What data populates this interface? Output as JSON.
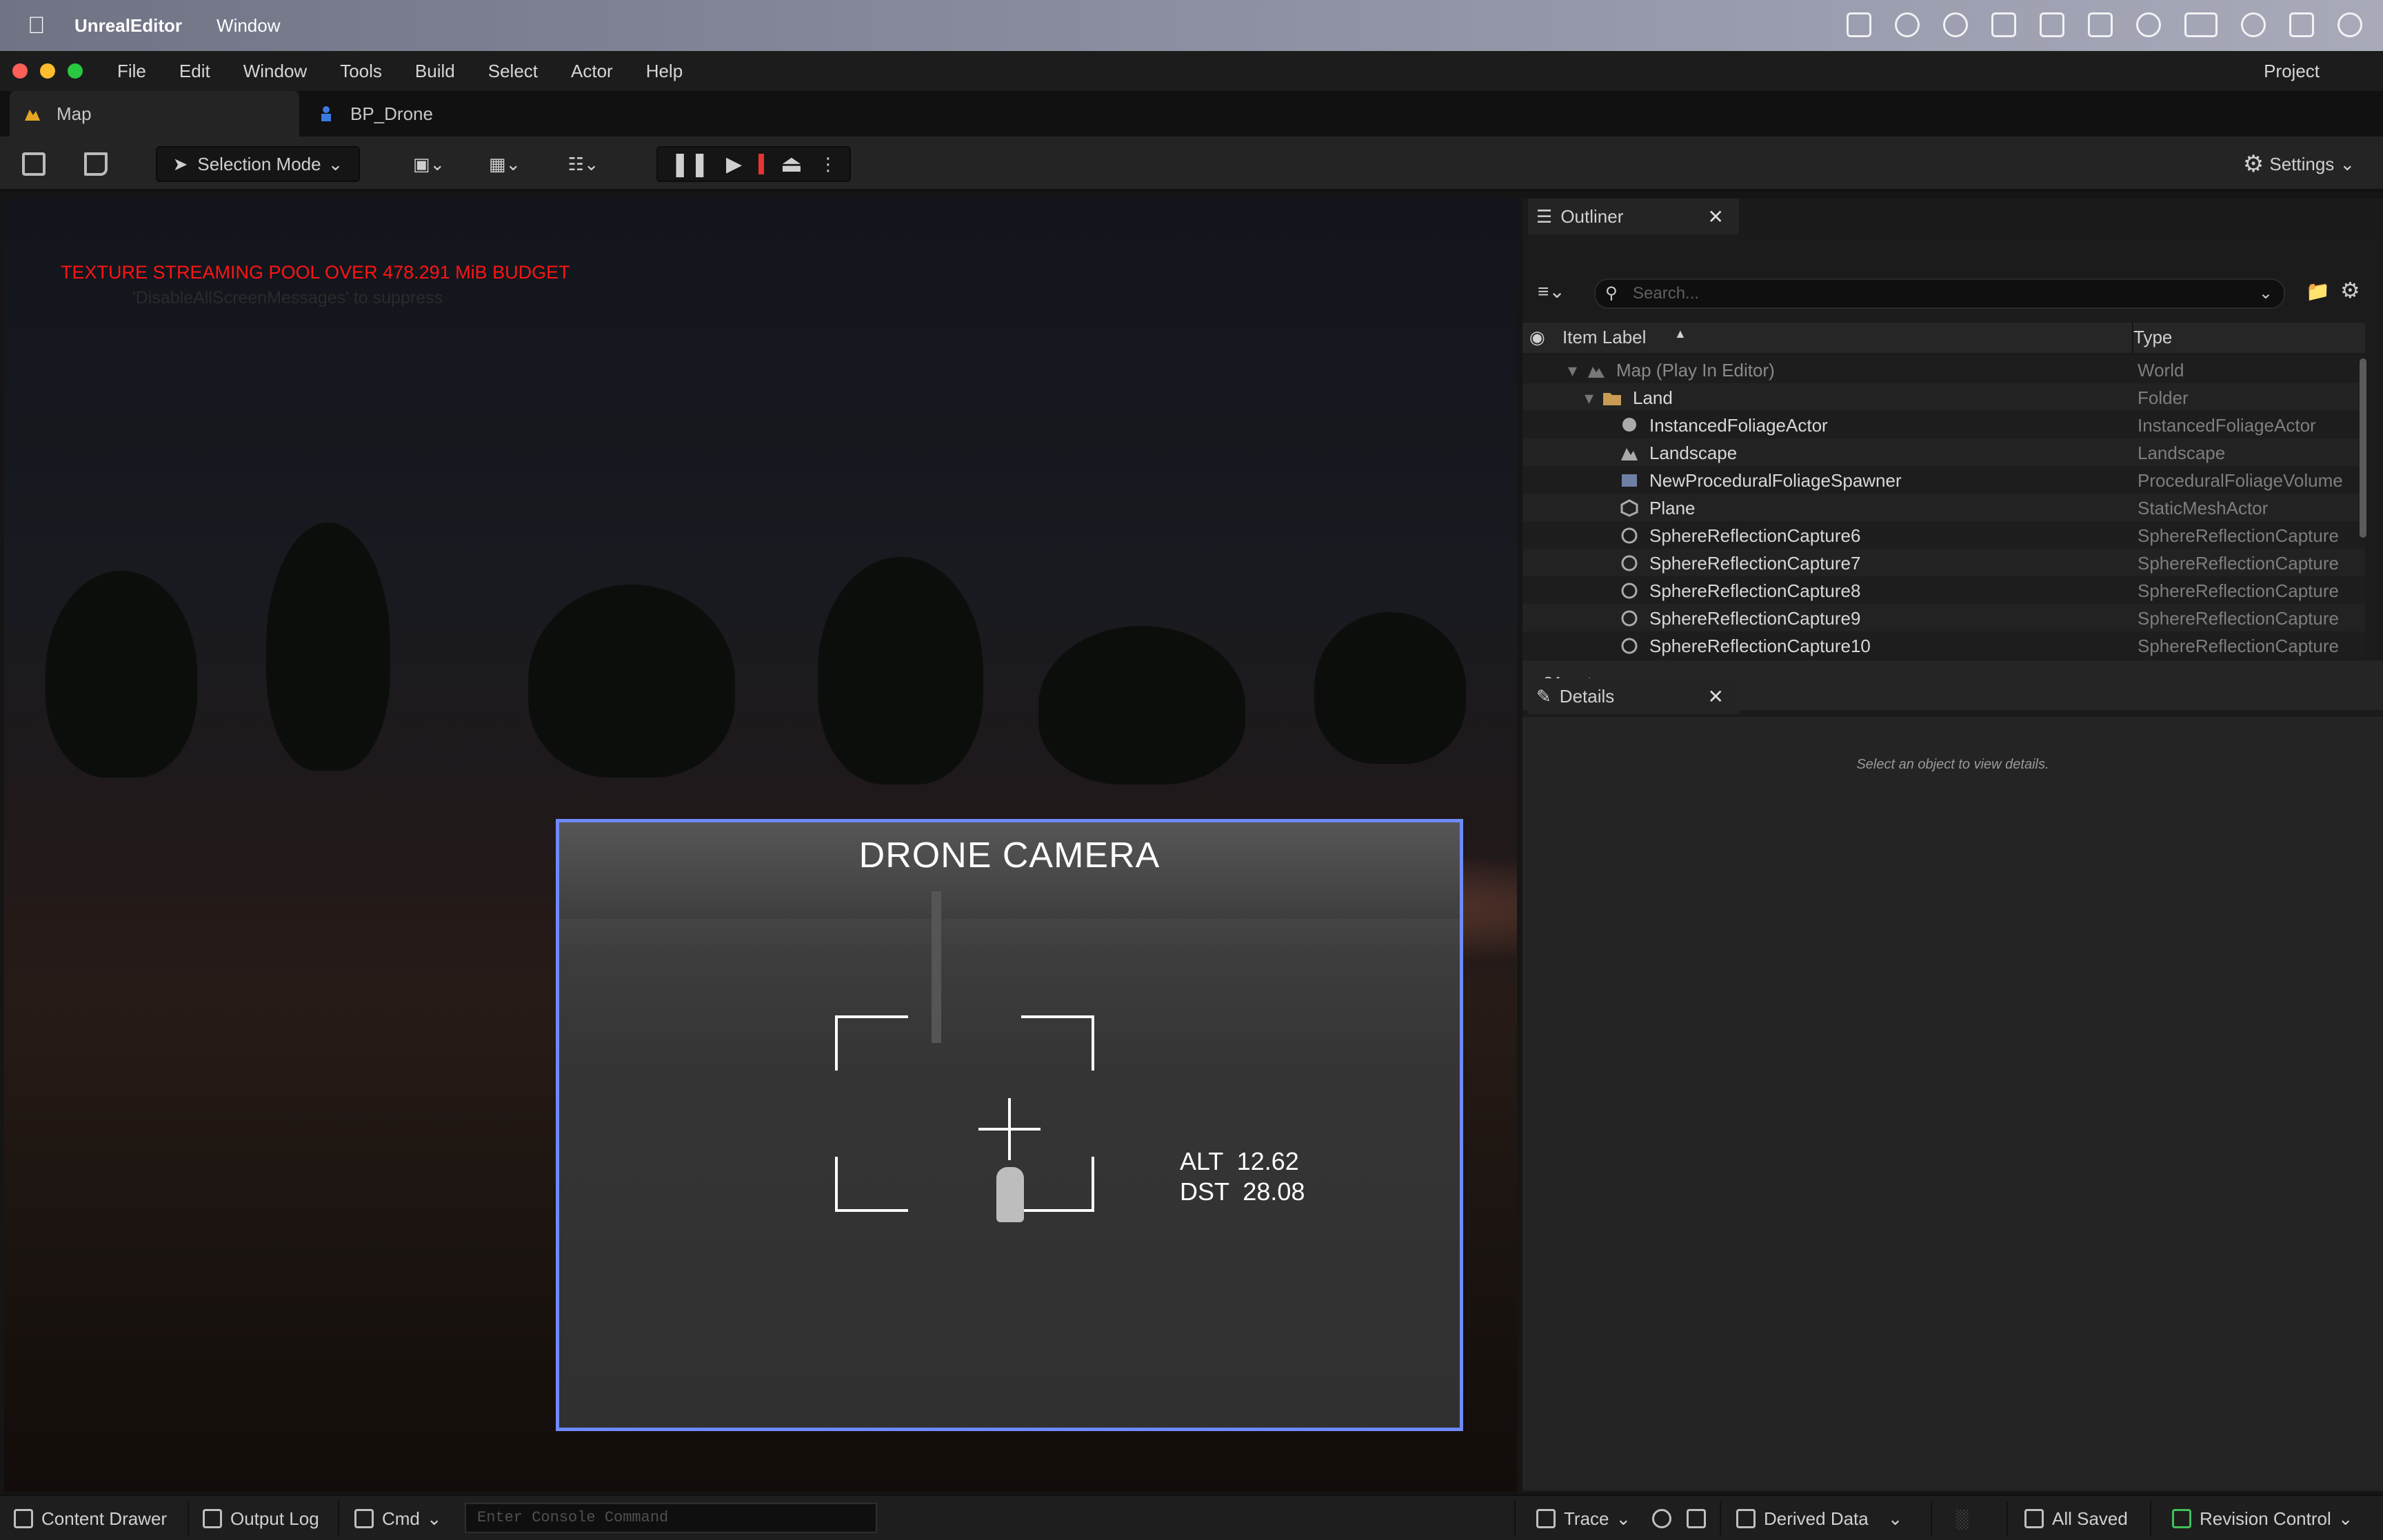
{
  "macos_menubar": {
    "app_name": "UnrealEditor",
    "window_menu": "Window"
  },
  "window": {
    "menus": [
      "File",
      "Edit",
      "Window",
      "Tools",
      "Build",
      "Select",
      "Actor",
      "Help"
    ],
    "project_label": "Project"
  },
  "tabs": [
    {
      "label": "Map",
      "active": true
    },
    {
      "label": "BP_Drone",
      "active": false
    }
  ],
  "toolbar": {
    "selection_mode": "Selection Mode",
    "settings": "Settings"
  },
  "viewport": {
    "warning": "TEXTURE STREAMING POOL OVER 478.291 MiB BUDGET",
    "warning_hint": "'DisableAllScreenMessages' to suppress",
    "drone_camera": {
      "title": "DRONE CAMERA",
      "alt_label": "ALT",
      "alt_value": "12.62",
      "dst_label": "DST",
      "dst_value": "28.08"
    }
  },
  "outliner": {
    "tab_label": "Outliner",
    "search_placeholder": "Search...",
    "columns": {
      "label": "Item Label",
      "type": "Type"
    },
    "rows": [
      {
        "label": "Map (Play In Editor)",
        "type": "World",
        "indent": 0,
        "icon": "map-icon"
      },
      {
        "label": "Land",
        "type": "Folder",
        "indent": 1,
        "icon": "folder-icon"
      },
      {
        "label": "InstancedFoliageActor",
        "type": "InstancedFoliageActor",
        "indent": 2,
        "icon": "foliage-icon"
      },
      {
        "label": "Landscape",
        "type": "Landscape",
        "indent": 2,
        "icon": "landscape-icon"
      },
      {
        "label": "NewProceduralFoliageSpawner",
        "type": "ProceduralFoliageVolume",
        "indent": 2,
        "icon": "volume-icon"
      },
      {
        "label": "Plane",
        "type": "StaticMeshActor",
        "indent": 2,
        "icon": "mesh-icon"
      },
      {
        "label": "SphereReflectionCapture6",
        "type": "SphereReflectionCapture",
        "indent": 2,
        "icon": "reflection-icon"
      },
      {
        "label": "SphereReflectionCapture7",
        "type": "SphereReflectionCapture",
        "indent": 2,
        "icon": "reflection-icon"
      },
      {
        "label": "SphereReflectionCapture8",
        "type": "SphereReflectionCapture",
        "indent": 2,
        "icon": "reflection-icon"
      },
      {
        "label": "SphereReflectionCapture9",
        "type": "SphereReflectionCapture",
        "indent": 2,
        "icon": "reflection-icon"
      },
      {
        "label": "SphereReflectionCapture10",
        "type": "SphereReflectionCapture",
        "indent": 2,
        "icon": "reflection-icon"
      }
    ],
    "actor_count": "31 actors"
  },
  "details": {
    "tab_label": "Details",
    "empty_hint": "Select an object to view details."
  },
  "statusbar": {
    "content_drawer": "Content Drawer",
    "output_log": "Output Log",
    "cmd": "Cmd",
    "console_placeholder": "Enter Console Command",
    "trace": "Trace",
    "derived_data": "Derived Data",
    "all_saved": "All Saved",
    "revision_control": "Revision Control"
  },
  "colors": {
    "warning_red": "#ff1414",
    "drone_border": "#6f89ff",
    "stop_red": "#e83434"
  }
}
